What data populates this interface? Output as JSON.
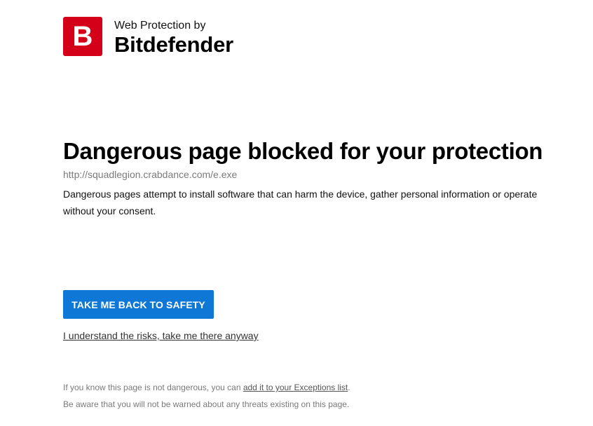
{
  "brand": {
    "logo_letter": "B",
    "logo_color": "#d4001a",
    "subtitle": "Web Protection by",
    "name": "Bitdefender"
  },
  "main": {
    "headline": "Dangerous page blocked for your protection",
    "blocked_url": "http://squadlegion.crabdance.com/e.exe",
    "description": "Dangerous pages attempt to install software that can harm the device, gather personal information or operate without your consent.",
    "safety_button_label": "TAKE ME BACK TO SAFETY",
    "safety_button_color": "#0f77d6",
    "risk_link_label": "I understand the risks, take me there anyway"
  },
  "footer": {
    "exception_prefix": "If you know this page is not dangerous, you can ",
    "exception_link": "add it to your Exceptions list",
    "exception_suffix": ".",
    "warning_note": "Be aware that you will not be warned about any threats existing on this page."
  }
}
